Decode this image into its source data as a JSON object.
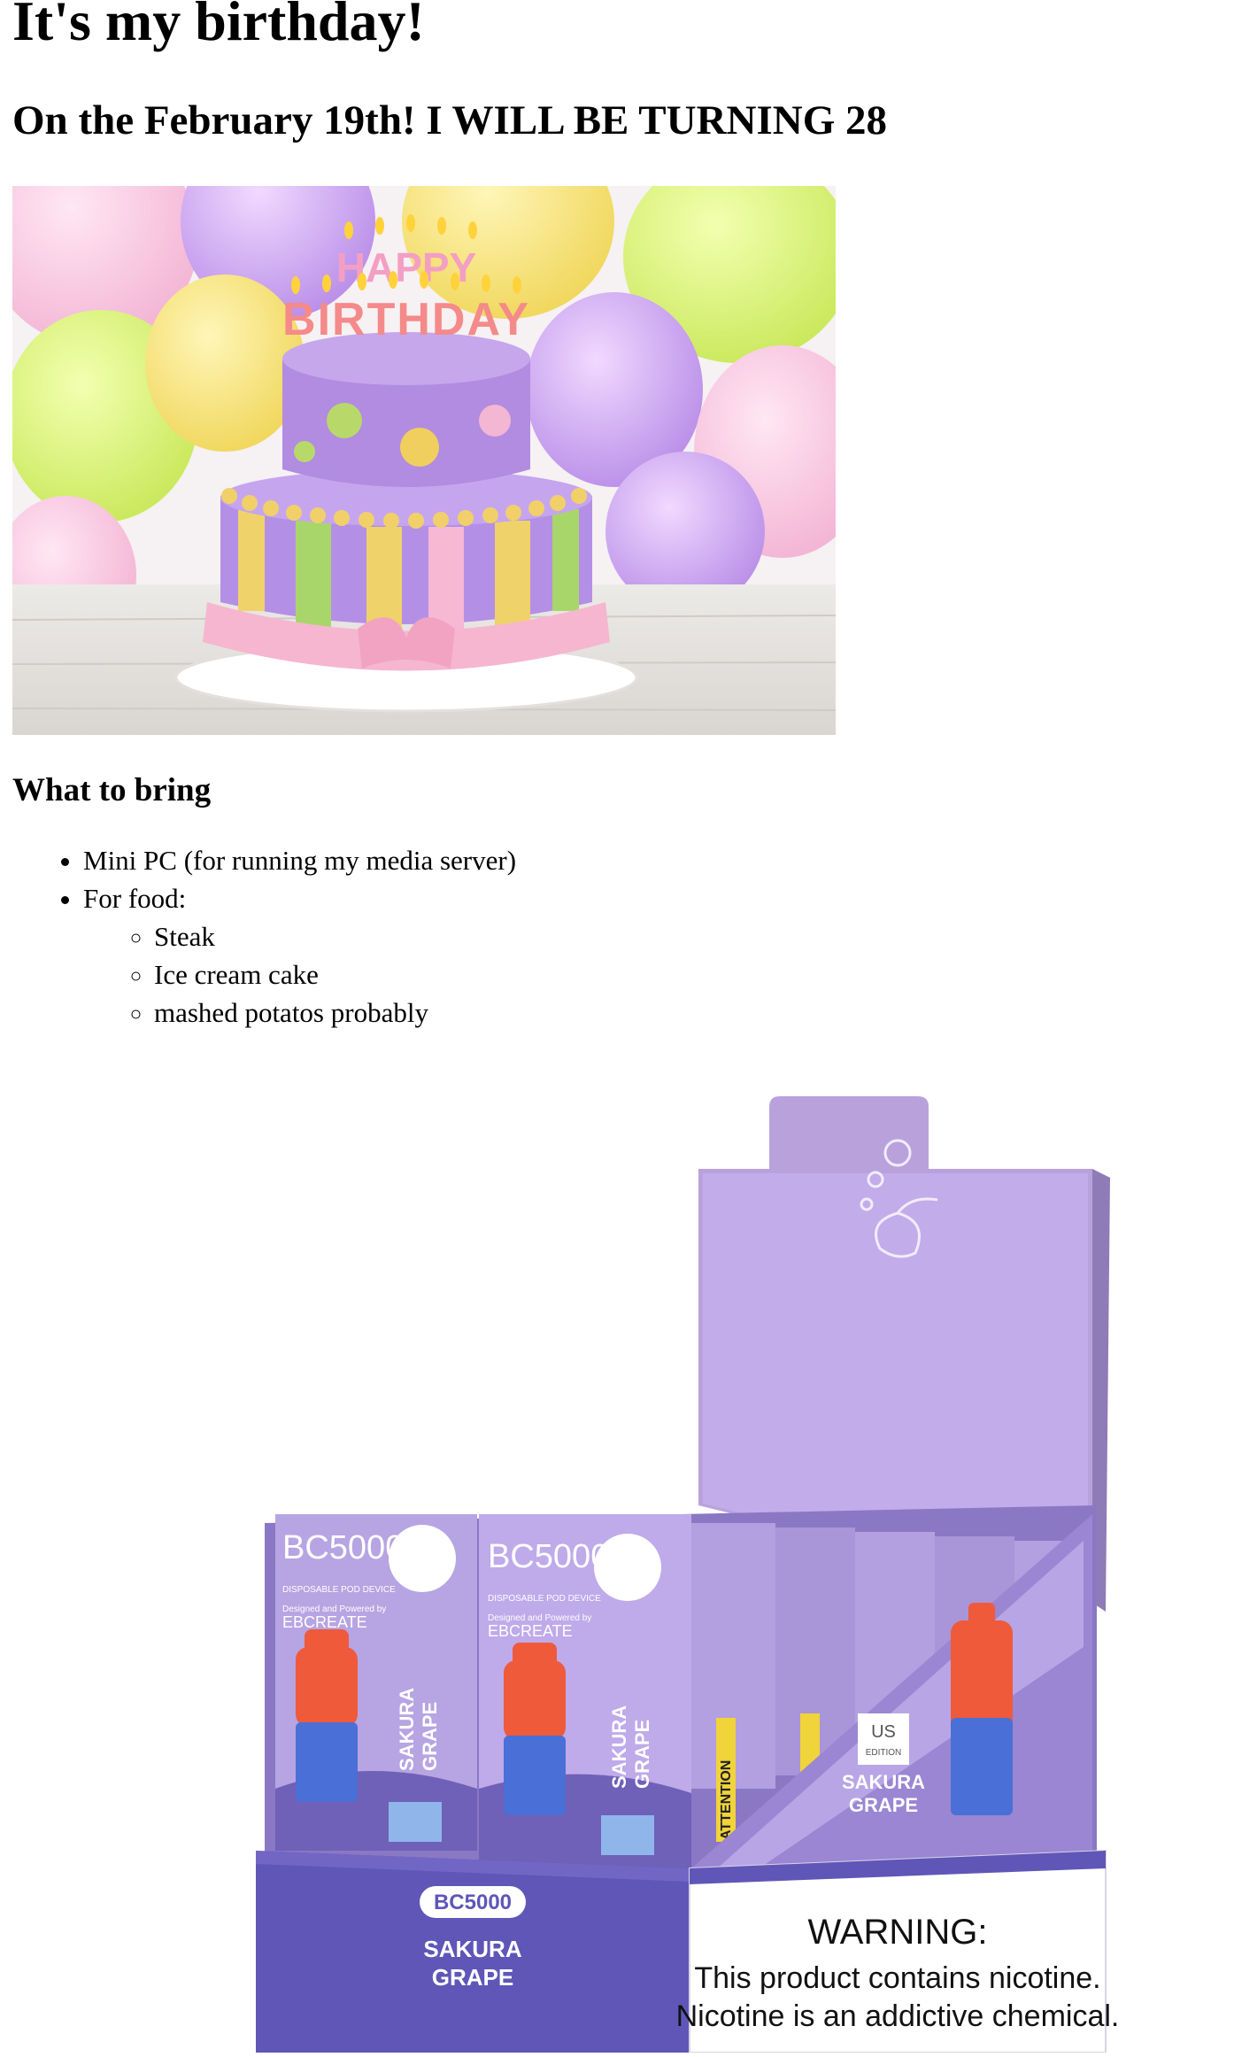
{
  "heading": "It's my birthday!",
  "subheading": "On the February 19th! I WILL BE TURNING 28",
  "cake_image": {
    "text_line_1": "HAPPY",
    "text_line_2": "BIRTHDAY"
  },
  "section_title": "What to bring",
  "bring_list": {
    "item1": "Mini PC (for running my media server)",
    "item2": "For food:",
    "food": [
      "Steak",
      "Ice cream cake",
      "mashed potatos probably"
    ]
  },
  "product_image": {
    "brand_small": "BC5000",
    "subtitle": "DISPOSABLE POD DEVICE",
    "designed_by": "Designed and Powered by",
    "maker": "EBCREATE",
    "flavor_line_1": "SAKURA",
    "flavor_line_2": "GRAPE",
    "edition_1": "US",
    "edition_2": "EDITION",
    "attention": "ATTENTION",
    "warning_title": "WARNING:",
    "warning_line_1": "This product contains nicotine.",
    "warning_line_2": "Nicotine is an addictive chemical."
  }
}
